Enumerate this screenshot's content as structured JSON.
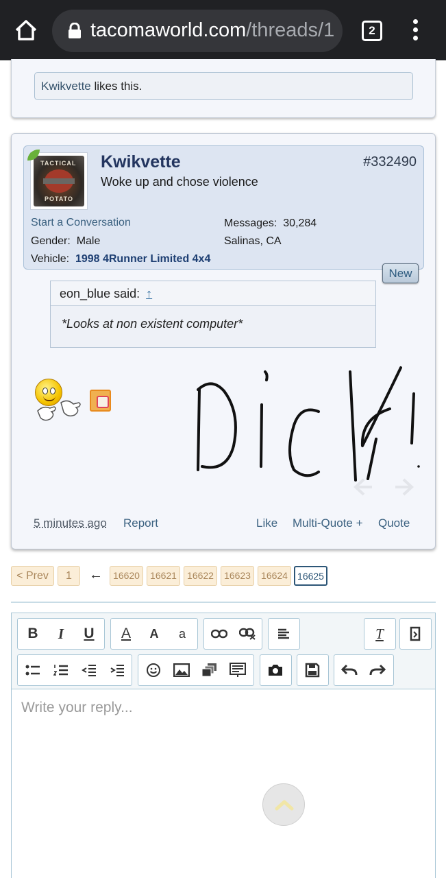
{
  "browser": {
    "url_domain": "tacomaworld.com",
    "url_path": "/threads/1",
    "tab_count": "2"
  },
  "previous_post": {
    "liker": "Kwikvette",
    "likes_suffix": " likes this."
  },
  "post": {
    "username": "Kwikvette",
    "user_title": "Woke up and chose violence",
    "post_number": "#332490",
    "avatar_text_top": "TACTICAL",
    "avatar_text_bottom": "POTATO",
    "start_conversation": "Start a Conversation",
    "gender_label": "Gender:",
    "gender_value": "Male",
    "vehicle_label": "Vehicle:",
    "vehicle_value": "1998 4Runner Limited 4x4",
    "messages_label": "Messages:",
    "messages_value": "30,284",
    "location": "Salinas, CA",
    "new_badge": "New",
    "quote_author": "eon_blue said:",
    "quote_arrow": "↑",
    "quote_text": "*Looks at non existent computer*",
    "timestamp": "5 minutes ago",
    "report": "Report",
    "like": "Like",
    "multi_quote": "Multi-Quote +",
    "quote": "Quote"
  },
  "pagination": {
    "prev": "< Prev",
    "first": "1",
    "arrow": "←",
    "pages": [
      "16620",
      "16621",
      "16622",
      "16623",
      "16624"
    ],
    "current": "16625"
  },
  "editor": {
    "placeholder": "Write your reply...",
    "bold": "B",
    "italic": "I",
    "underline": "U",
    "font_color": "A",
    "font_size": "A",
    "font_family": "a",
    "remove_format": "T"
  },
  "colors": {
    "browser_bar": "#202124",
    "username": "#23355f",
    "link": "#3b6180",
    "page_current": "#2d5677"
  }
}
